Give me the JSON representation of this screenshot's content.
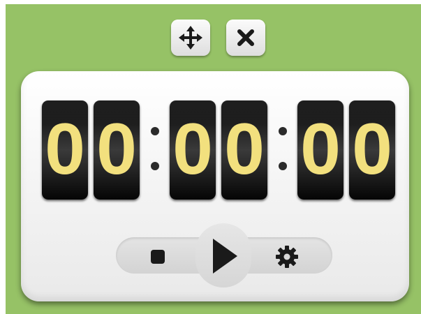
{
  "toolbar": {
    "move_icon": "move-arrows-icon",
    "close_icon": "close-x-icon"
  },
  "timer": {
    "digits": [
      "0",
      "0",
      "0",
      "0",
      "0",
      "0"
    ],
    "separator": ":"
  },
  "controls": {
    "stop_icon": "stop-icon",
    "play_icon": "play-icon",
    "settings_icon": "gear-icon"
  },
  "colors": {
    "background": "#96c266",
    "digit_color": "#f2e07e",
    "card_color": "#1c1c1c",
    "panel_color": "#f4f4f4"
  }
}
